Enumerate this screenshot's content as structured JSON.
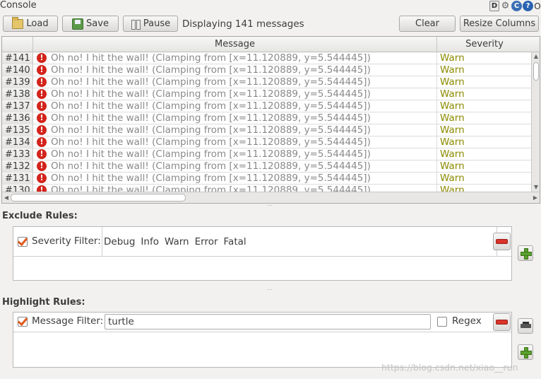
{
  "window": {
    "title": "Console",
    "title_icons": [
      {
        "name": "d-icon",
        "glyph": "D"
      },
      {
        "name": "gear-icon",
        "glyph": "⚙"
      },
      {
        "name": "refresh-icon",
        "glyph": "C"
      },
      {
        "name": "help-icon",
        "glyph": "?"
      },
      {
        "name": "close-icon",
        "glyph": "O"
      }
    ]
  },
  "toolbar": {
    "load_label": "Load",
    "save_label": "Save",
    "pause_label": "Pause",
    "status": "Displaying 141 messages",
    "clear_label": "Clear",
    "resize_label": "Resize Columns"
  },
  "table": {
    "columns": [
      "Message",
      "Severity"
    ],
    "rows": [
      {
        "id": "#141",
        "message": "Oh no! I hit the wall! (Clamping from [x=11.120889, y=5.544445])",
        "severity": "Warn"
      },
      {
        "id": "#140",
        "message": "Oh no! I hit the wall! (Clamping from [x=11.120889, y=5.544445])",
        "severity": "Warn"
      },
      {
        "id": "#139",
        "message": "Oh no! I hit the wall! (Clamping from [x=11.120889, y=5.544445])",
        "severity": "Warn"
      },
      {
        "id": "#138",
        "message": "Oh no! I hit the wall! (Clamping from [x=11.120889, y=5.544445])",
        "severity": "Warn"
      },
      {
        "id": "#137",
        "message": "Oh no! I hit the wall! (Clamping from [x=11.120889, y=5.544445])",
        "severity": "Warn"
      },
      {
        "id": "#136",
        "message": "Oh no! I hit the wall! (Clamping from [x=11.120889, y=5.544445])",
        "severity": "Warn"
      },
      {
        "id": "#135",
        "message": "Oh no! I hit the wall! (Clamping from [x=11.120889, y=5.544445])",
        "severity": "Warn"
      },
      {
        "id": "#134",
        "message": "Oh no! I hit the wall! (Clamping from [x=11.120889, y=5.544445])",
        "severity": "Warn"
      },
      {
        "id": "#133",
        "message": "Oh no! I hit the wall! (Clamping from [x=11.120889, y=5.544445])",
        "severity": "Warn"
      },
      {
        "id": "#132",
        "message": "Oh no! I hit the wall! (Clamping from [x=11.120889, y=5.544445])",
        "severity": "Warn"
      },
      {
        "id": "#131",
        "message": "Oh no! I hit the wall! (Clamping from [x=11.120889, y=5.544445])",
        "severity": "Warn"
      },
      {
        "id": "#130",
        "message": "Oh no! I hit the wall! (Clamping from [x=11.120889, y=5.544445])",
        "severity": "Warn"
      }
    ]
  },
  "exclude": {
    "title": "Exclude Rules:",
    "severity_filter_label": "Severity Filter:",
    "severities": [
      "Debug",
      "Info",
      "Warn",
      "Error",
      "Fatal"
    ]
  },
  "highlight": {
    "title": "Highlight Rules:",
    "message_filter_label": "Message Filter:",
    "message_filter_value": "turtle",
    "regex_label": "Regex"
  },
  "watermark": "https://blog.csdn.net/xiao__run",
  "colors": {
    "severity_warn": "#8b8a00",
    "error_icon": "#d3241c",
    "add_green": "#5aa02c",
    "remove_red": "#d9342b"
  }
}
